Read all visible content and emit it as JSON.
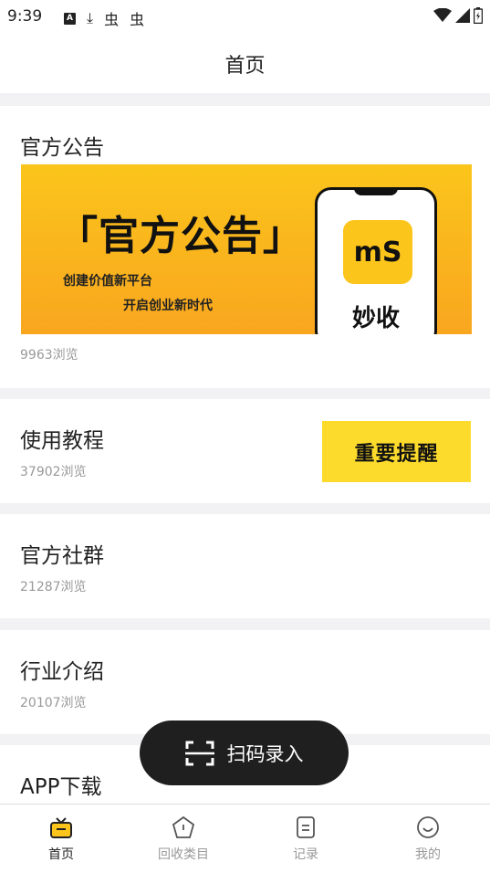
{
  "status_bar": {
    "time": "9:39",
    "left_icons": [
      "A",
      "⤓",
      "虫",
      "虫"
    ],
    "right_icons": [
      "wifi-icon",
      "signal-icon",
      "battery-icon"
    ]
  },
  "header": {
    "title": "首页"
  },
  "announcement": {
    "title": "官方公告",
    "banner": {
      "headline": "「官方公告」",
      "line1": "创建价值新平台",
      "line2": "开启创业新时代",
      "app_icon_text": "mS",
      "app_name": "妙收"
    },
    "views": "9963浏览"
  },
  "items": [
    {
      "title": "使用教程",
      "views": "37902浏览",
      "badge": "重要提醒"
    },
    {
      "title": "官方社群",
      "views": "21287浏览"
    },
    {
      "title": "行业介绍",
      "views": "20107浏览"
    },
    {
      "title": "APP下载"
    }
  ],
  "scan_button": {
    "label": "扫码录入",
    "icon": "scan-icon"
  },
  "tabbar": {
    "tabs": [
      {
        "label": "首页",
        "icon": "home-icon",
        "active": true
      },
      {
        "label": "回收类目",
        "icon": "category-icon",
        "active": false
      },
      {
        "label": "记录",
        "icon": "record-icon",
        "active": false
      },
      {
        "label": "我的",
        "icon": "profile-icon",
        "active": false
      }
    ]
  },
  "colors": {
    "accent": "#fbc51b",
    "badge": "#fddb2c",
    "dark": "#1f1f1f",
    "muted": "#999999"
  }
}
